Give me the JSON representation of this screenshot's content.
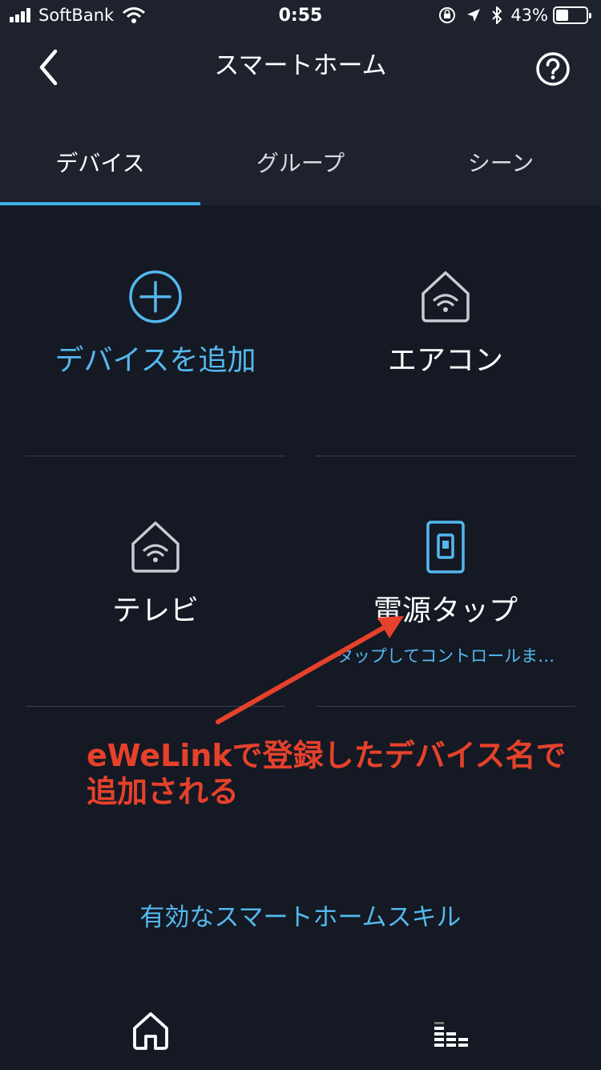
{
  "status_bar": {
    "carrier": "SoftBank",
    "time": "0:55",
    "battery_percent": "43%",
    "battery_level": 0.43
  },
  "header": {
    "title": "スマートホーム"
  },
  "tabs": [
    {
      "label": "デバイス",
      "active": true
    },
    {
      "label": "グループ",
      "active": false
    },
    {
      "label": "シーン",
      "active": false
    }
  ],
  "devices": {
    "add": {
      "label": "デバイスを追加",
      "icon": "add-circle-icon"
    },
    "items": [
      {
        "name": "エアコン",
        "icon": "smart-home-wifi-icon"
      },
      {
        "name": "テレビ",
        "icon": "smart-home-wifi-icon"
      },
      {
        "name": "電源タップ",
        "icon": "switch-icon",
        "subtitle": "タップしてコントロールま…"
      }
    ]
  },
  "annotation": {
    "text": "eWeLinkで登録したデバイス名で追加される",
    "color": "#e6412b"
  },
  "skills_link": "有効なスマートホームスキル",
  "bottom_nav": [
    {
      "icon": "home-icon"
    },
    {
      "icon": "equalizer-icon"
    }
  ],
  "colors": {
    "accent": "#3fb1ea",
    "background": "#141923",
    "header": "#1d222d"
  }
}
